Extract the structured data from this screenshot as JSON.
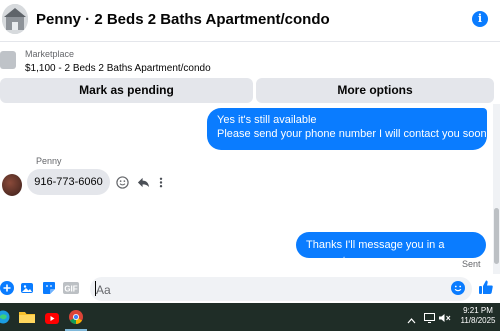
{
  "header": {
    "title": "Penny · 2 Beds 2 Baths Apartment/condo",
    "info_icon": "info-icon"
  },
  "listing": {
    "label": "Marketplace",
    "description": "$1,100 - 2 Beds 2 Baths Apartment/condo",
    "mark_pending_label": "Mark as pending",
    "more_options_label": "More options"
  },
  "messages": {
    "outgoing_1_line1": "Yes it's still available",
    "outgoing_1_line2": "Please send your phone number I will contact you soon.",
    "sender_name": "Penny",
    "incoming_1": "916-773-6060",
    "outgoing_2": "Thanks I'll message you in a moment",
    "status": "Sent"
  },
  "composer": {
    "placeholder": "Aa"
  },
  "taskbar": {
    "time": "9:21 PM",
    "date": "11/8/2025"
  },
  "colors": {
    "accent": "#0a7cff",
    "bubble_in": "#e4e6eb",
    "taskbar": "#1f2d27"
  }
}
